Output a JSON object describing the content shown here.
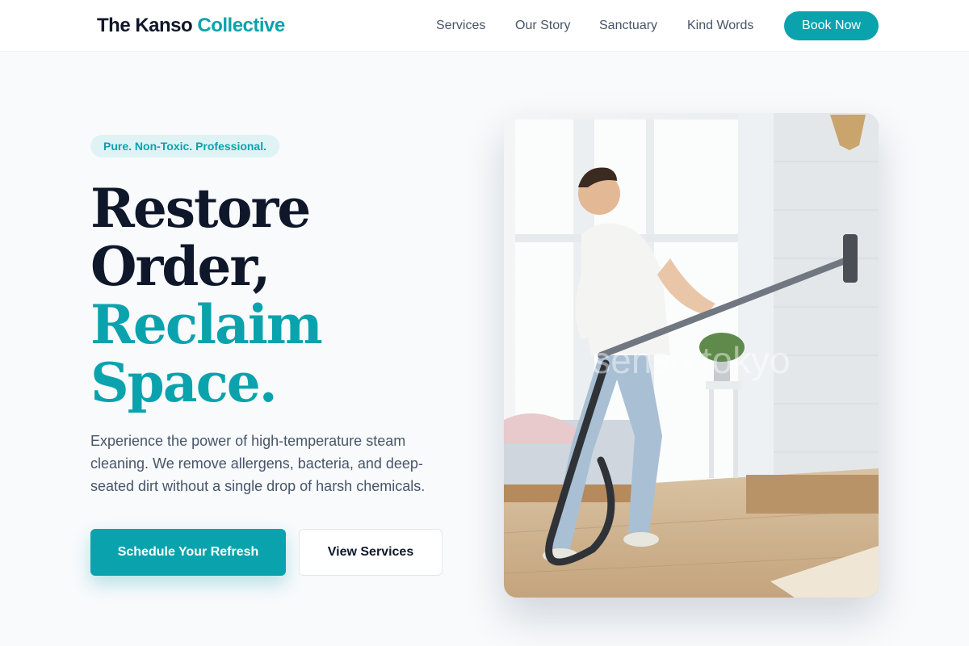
{
  "nav": {
    "logo_part1": "The Kanso ",
    "logo_part2": "Collective",
    "links": [
      "Services",
      "Our Story",
      "Sanctuary",
      "Kind Words"
    ],
    "cta": "Book Now"
  },
  "hero": {
    "badge": "Pure. Non-Toxic. Professional.",
    "headline_lines": [
      "Restore",
      "Order,",
      "Reclaim",
      "Space."
    ],
    "description": "Experience the power of high-temperature steam cleaning. We remove allergens, bacteria, and deep-seated dirt without a single drop of harsh chemicals.",
    "primary_cta": "Schedule Your Refresh",
    "secondary_cta": "View Services",
    "image_watermark": "senso.tokyo"
  },
  "colors": {
    "accent": "#0aa3ad",
    "text_dark": "#0f172a",
    "text_muted": "#475569",
    "background": "#f8fafc"
  }
}
